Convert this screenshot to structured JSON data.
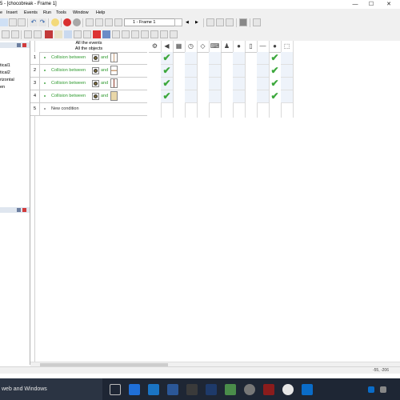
{
  "window": {
    "title": "5 - [chocobreak - Frame 1]",
    "controls": [
      "—",
      "☐",
      "✕"
    ]
  },
  "menu": [
    "e",
    "Insert",
    "Events",
    "Run",
    "Tools",
    "Window",
    "Help"
  ],
  "toolbar": {
    "frame_select": "1 - Frame 1",
    "prev": "◀",
    "next": "▶"
  },
  "objects_panel": {
    "items": [
      "tical1",
      "tical2",
      "rizontal",
      "en"
    ]
  },
  "event_editor": {
    "header_line1": "All the events",
    "header_line2": "All the objects",
    "rows": [
      {
        "num": "1",
        "text": "Collision between",
        "and": "and"
      },
      {
        "num": "2",
        "text": "Collision between",
        "and": "and"
      },
      {
        "num": "3",
        "text": "Collision between",
        "and": "and"
      },
      {
        "num": "4",
        "text": "Collision between",
        "and": "and"
      }
    ],
    "new_row": {
      "num": "5",
      "text": "New condition"
    },
    "column_icons": [
      "special-conditions-icon",
      "sound-icon",
      "storyboard-icon",
      "timer-icon",
      "create-object-icon",
      "keyboard-mouse-icon",
      "player-icon",
      "ball-object-icon",
      "paddle-object-icon",
      "backdrop-icon",
      "ball-object-icon",
      "brick-object-icon"
    ]
  },
  "statusbar": {
    "coords": "-55, -206"
  },
  "taskbar": {
    "search_text": "web and Windows"
  },
  "colors": {
    "check": "#3da83d",
    "condition_text": "#2f9a2f",
    "taskbar": "#1e2634"
  }
}
